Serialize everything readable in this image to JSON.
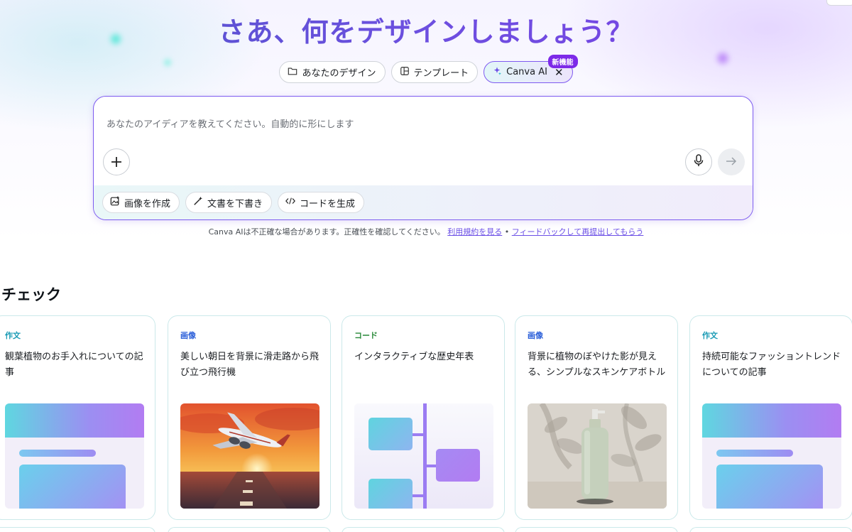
{
  "title": "さあ、何をデザインしましょう？",
  "tabs": [
    {
      "label": "あなたのデザイン",
      "icon": "folder-icon"
    },
    {
      "label": "テンプレート",
      "icon": "template-icon"
    },
    {
      "label": "Canva AI",
      "icon": "sparkle-icon",
      "badge": "新機能"
    }
  ],
  "prompt": {
    "placeholder": "あなたのアイディアを教えてください。自動的に形にします",
    "chips": [
      {
        "label": "画像を作成",
        "icon": "image-create-icon"
      },
      {
        "label": "文書を下書き",
        "icon": "magic-pen-icon"
      },
      {
        "label": "コードを生成",
        "icon": "code-icon"
      }
    ]
  },
  "disclaimer": {
    "text": "Canva AIは不正確な場合があります。正確性を確認してください。",
    "link1": "利用規約を見る",
    "separator": "•",
    "link2": "フィードバックして再提出してもらう"
  },
  "section_title": "チェック",
  "cards": [
    {
      "category": "作文",
      "description": "観葉植物のお手入れについての記事",
      "thumb": "document-preview"
    },
    {
      "category": "画像",
      "description": "美しい朝日を背景に滑走路から飛び立つ飛行機",
      "thumb": "airplane-sunrise-photo"
    },
    {
      "category": "コード",
      "description": "インタラクティブな歴史年表",
      "thumb": "timeline-preview"
    },
    {
      "category": "画像",
      "description": "背景に植物のぼやけた影が見える、シンプルなスキンケアボトル",
      "thumb": "skincare-bottle-photo"
    },
    {
      "category": "作文",
      "description": "持続可能なファッショントレンドについての記事",
      "thumb": "document-preview"
    }
  ],
  "colors": {
    "accent": "#7d2ae8",
    "title_gradient_start": "#4e54c8",
    "title_gradient_end": "#7b3fe4",
    "link": "#6b4fe6"
  }
}
